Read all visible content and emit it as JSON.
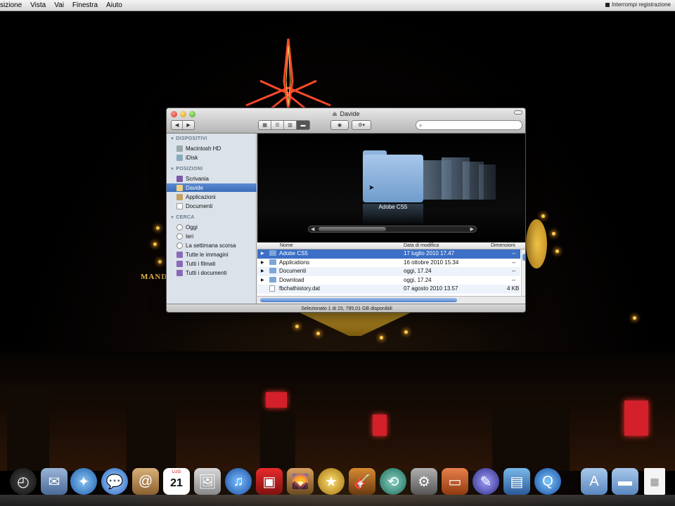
{
  "menubar": {
    "items": [
      "sizione",
      "Vista",
      "Vai",
      "Finestra",
      "Aiuto"
    ],
    "right_label": "Interrompi registrazione"
  },
  "finder": {
    "title": "Davide",
    "sidebar": {
      "sections": [
        {
          "label": "DISPOSITIVI",
          "items": [
            "Macintosh HD",
            "iDisk"
          ]
        },
        {
          "label": "POSIZIONI",
          "items": [
            "Scrivania",
            "Davide",
            "Applicazioni",
            "Documenti"
          ]
        },
        {
          "label": "CERCA",
          "items": [
            "Oggi",
            "Ieri",
            "La settimana scorsa",
            "Tutte le immagini",
            "Tutti i filmati",
            "Tutti i documenti"
          ]
        }
      ],
      "selected": "Davide"
    },
    "coverflow": {
      "current_label": "Adobe CS5"
    },
    "list": {
      "columns": [
        "Nome",
        "Data di modifica",
        "Dimensioni"
      ],
      "rows": [
        {
          "name": "Adobe CS5",
          "date": "17 luglio 2010 17.47",
          "size": "--",
          "selected": true
        },
        {
          "name": "Applications",
          "date": "16 ottobre 2010 15.34",
          "size": "--"
        },
        {
          "name": "Documenti",
          "date": "oggi, 17.24",
          "size": "--"
        },
        {
          "name": "Download",
          "date": "oggi, 17.24",
          "size": "--"
        },
        {
          "name": "fbchathistory.dat",
          "date": "07 agosto 2010 13.57",
          "size": "4 KB"
        }
      ]
    },
    "status_text": "Selezionato 1 di 15, 795,01 GB disponibili"
  },
  "desktop": {
    "sign_text": "MAND"
  },
  "dock": {
    "calendar_month": "LUG",
    "calendar_day": "21"
  }
}
